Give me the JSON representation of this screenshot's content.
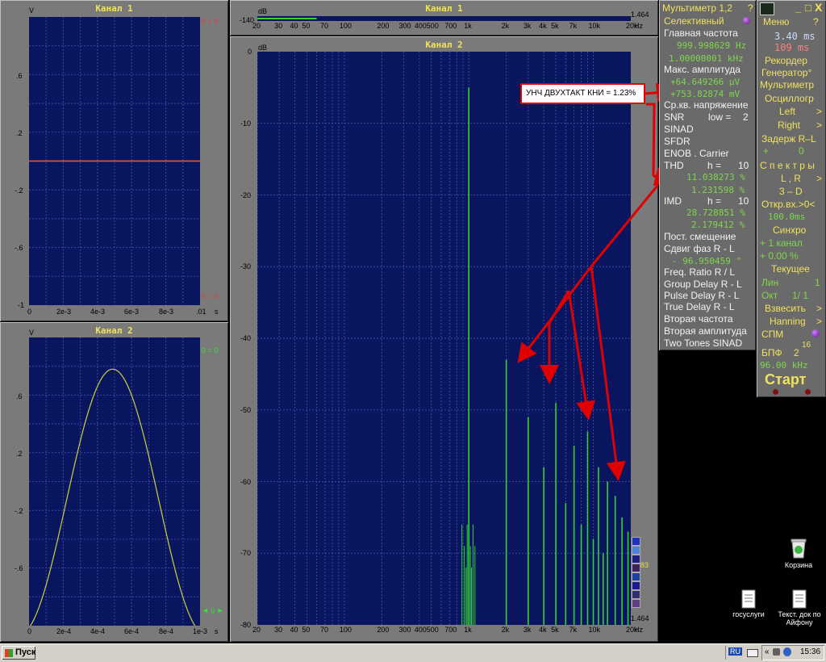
{
  "colors": {
    "plot_bg": "#0a1560",
    "grid": "#3a4aa0",
    "trace_green": "#32d232",
    "trace_yellow": "#c8d23c",
    "trace_red": "#e06040",
    "title_yellow": "#f0e25a",
    "value_green": "#7fd64a",
    "arrow_red": "#e00000",
    "panel_gray": "#7a7a7a"
  },
  "ch1_time": {
    "title": "Канал 1",
    "v_unit": "V",
    "y_ticks": [
      "",
      ".6",
      ".2",
      "-.2",
      "-.6",
      "-1"
    ],
    "x_ticks": [
      "0",
      "2e-3",
      "4e-3",
      "6e-3",
      "8e-3",
      ".01",
      "s"
    ],
    "marker_top": "0 = 0",
    "marker_bottom": "4 = 4"
  },
  "ch2_time": {
    "title": "Канал 2",
    "v_unit": "V",
    "y_ticks": [
      "",
      ".6",
      ".2",
      "-.2",
      "-.6",
      "-1"
    ],
    "x_ticks": [
      "0",
      "2e-4",
      "4e-4",
      "6e-4",
      "8e-4",
      "1e-3",
      "s"
    ],
    "marker_top": "0 = 0",
    "marker_bottom": "◄ || ►"
  },
  "spec_ch1": {
    "title": "Канал 1",
    "db_unit": "dB",
    "level": "-140",
    "right_value": "1.464",
    "x_ticks": [
      "20",
      "30",
      "40",
      "50",
      "70",
      "100",
      "200",
      "300",
      "400",
      "500",
      "700",
      "1k",
      "2k",
      "3k",
      "4k",
      "5k",
      "7k",
      "10k",
      "20k",
      "Hz"
    ]
  },
  "spec_ch2": {
    "title": "Канал 2",
    "db_unit": "dB",
    "y_ticks": [
      "0",
      "-10",
      "-20",
      "-30",
      "-40",
      "-50",
      "-60",
      "-70",
      "-80"
    ],
    "x_ticks": [
      "20",
      "30",
      "40",
      "50",
      "70",
      "100",
      "200",
      "300",
      "400",
      "500",
      "700",
      "1k",
      "2k",
      "3k",
      "4k",
      "5k",
      "7k",
      "10k",
      "20k",
      "Hz"
    ],
    "right_value": "1.464",
    "swatch_label": "83"
  },
  "chart_data": {
    "type": "bar",
    "title": "Канал 2",
    "xlabel": "Hz",
    "ylabel": "dB",
    "ylim": [
      -80,
      0
    ],
    "x_scale": "log",
    "xlim": [
      20,
      20000
    ],
    "harmonics": [
      {
        "freq": 1000,
        "db": -5
      },
      {
        "freq": 2000,
        "db": -43
      },
      {
        "freq": 3000,
        "db": -51
      },
      {
        "freq": 4000,
        "db": -58
      },
      {
        "freq": 5000,
        "db": -49
      },
      {
        "freq": 6000,
        "db": -63
      },
      {
        "freq": 7000,
        "db": -55
      },
      {
        "freq": 8000,
        "db": -66
      },
      {
        "freq": 9000,
        "db": -53
      },
      {
        "freq": 10000,
        "db": -68
      },
      {
        "freq": 11000,
        "db": -58
      },
      {
        "freq": 12000,
        "db": -70
      },
      {
        "freq": 13000,
        "db": -60
      },
      {
        "freq": 15000,
        "db": -62
      },
      {
        "freq": 17000,
        "db": -65
      },
      {
        "freq": 19000,
        "db": -67
      }
    ]
  },
  "annotation": "УНЧ ДВУХТАКТ  КНИ = 1.23%",
  "multimeter": {
    "title": "Мультиметр 1,2",
    "help": "?",
    "mode": "Селективный",
    "main_freq_label": "Главная частота",
    "main_freq_value1": "999.998629 Hz",
    "main_freq_value2": "1.00000001 kHz",
    "max_amp_label": "Макс. амплитуда",
    "max_amp_value1": "+64.649266 µV",
    "max_amp_value2": "+753.82874 mV",
    "rms_label": "Ср.кв. напряжение",
    "snr_label": "SNR",
    "snr_low": "low =",
    "snr_low_value": "2",
    "sinad": "SINAD",
    "sfdr": "SFDR",
    "enob": "ENOB . Carrier",
    "thd_label": "THD",
    "thd_h": "h =",
    "thd_h_value": "10",
    "thd_value1": "11.038273 %",
    "thd_value2": "1.231598 %",
    "imd_label": "IMD",
    "imd_h": "h =",
    "imd_h_value": "10",
    "imd_value1": "28.728851 %",
    "imd_value2": "2.179412 %",
    "dc_offset": "Пост. смещение",
    "phase_label": "Сдвиг фаз R - L",
    "phase_value": "- 96.950459 °",
    "freq_ratio": "Freq. Ratio  R / L",
    "group_delay": "Group Delay R - L",
    "pulse_delay": "Pulse Delay R - L",
    "true_delay": "True Delay R - L",
    "second_freq": "Вторая частота",
    "second_amp": "Вторая амплитуда",
    "two_tones": "Two Tones SINAD"
  },
  "control": {
    "menu": "Меню",
    "help": "?",
    "time1": "3.40 ms",
    "time2": "109 ms",
    "recorder": "Рекордер",
    "generator": "Генератор°",
    "multimeter": "Мультиметр",
    "oscillograph": "Осциллогр",
    "left": "Left",
    "right": "Right",
    "delay_label": "Задерж R–L",
    "delay_plus": "+",
    "delay_value": "0",
    "spectra": "С п е к т р ы",
    "lr": "L , R",
    "three_d": "3 – D",
    "open_input": "Откр.вх.>0<",
    "open_value": "100.0ms",
    "sync": "Синхро",
    "sync_channel": "+ 1 канал",
    "sync_percent": "+ 0.00 %",
    "current": "Текущее",
    "lin": "Лин",
    "lin_value": "1",
    "oct": "Окт",
    "oct_value": "1/ 1",
    "weight": "Взвесить",
    "hanning": "Hanning",
    "spm": "СПМ",
    "fft_label": "БПФ",
    "fft_base": "2",
    "fft_exp": "16",
    "sample_rate": "96.00 kHz",
    "start": "Старт",
    "win_min": "_",
    "win_max": "□",
    "win_close": "X"
  },
  "desktop": {
    "recycle": "Корзина",
    "gosuslugi": "госуслуги",
    "text_doc": "Текст. док по Айфону"
  },
  "taskbar": {
    "start": "Пуск",
    "lang": "RU",
    "clock": "15:36"
  }
}
